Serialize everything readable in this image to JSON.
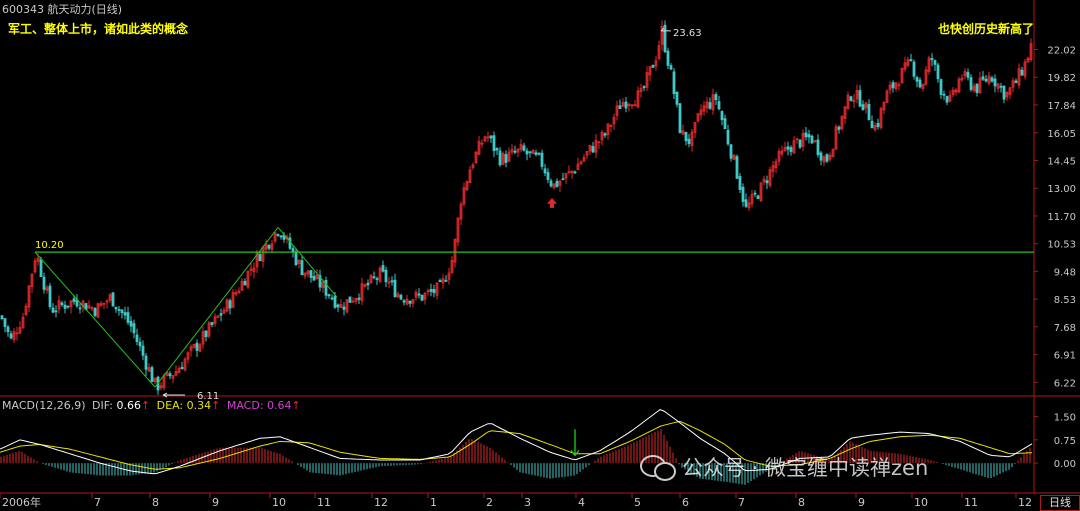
{
  "header": {
    "code": "600343",
    "name": "航天动力",
    "period": "(日线)"
  },
  "annotations": {
    "left_note": "军工、整体上市，诸如此类的概念",
    "right_note": "也快创历史新高了",
    "high_label": "23.63",
    "low_label": "6.11",
    "resistance_label": "10.20"
  },
  "macd": {
    "title": "MACD(12,26,9)",
    "dif_label": "DIF:",
    "dif_value": "0.66",
    "dea_label": "DEA:",
    "dea_value": "0.34",
    "macd_label": "MACD:",
    "macd_value": "0.64"
  },
  "watermark": "公众号 · 微宝缠中读禅zen",
  "period_box": "日线",
  "colors": {
    "background": "#000000",
    "axis_red": "#b01818",
    "up_candle": "#e0292a",
    "down_candle": "#3fc8c8",
    "resistance_line": "#22c322",
    "dif_line": "#ffffff",
    "dea_line": "#e8e200",
    "label_yellow": "#ffff00",
    "macd_purple": "#d040d0"
  },
  "chart_data": [
    {
      "type": "candlestick",
      "title": "600343 航天动力(日线)",
      "yscale": "log",
      "y_ticks": [
        6.22,
        6.91,
        7.68,
        8.53,
        9.48,
        10.53,
        11.7,
        13.0,
        14.45,
        16.05,
        17.84,
        19.82,
        22.02
      ],
      "ylim": [
        5.95,
        25.2
      ],
      "x_ticks": [
        "2006年",
        "7",
        "8",
        "9",
        "10",
        "11",
        "12",
        "1",
        "2",
        "3",
        "4",
        "5",
        "6",
        "7",
        "8",
        "9",
        "10",
        "11",
        "12"
      ],
      "close_path": [
        [
          0,
          8.0
        ],
        [
          10,
          7.3
        ],
        [
          22,
          8.0
        ],
        [
          35,
          10.2
        ],
        [
          50,
          8.2
        ],
        [
          75,
          8.5
        ],
        [
          95,
          8.2
        ],
        [
          110,
          8.6
        ],
        [
          130,
          7.7
        ],
        [
          155,
          6.11
        ],
        [
          175,
          6.5
        ],
        [
          200,
          7.3
        ],
        [
          230,
          8.5
        ],
        [
          260,
          10.2
        ],
        [
          278,
          11.2
        ],
        [
          300,
          9.6
        ],
        [
          320,
          9.0
        ],
        [
          340,
          8.3
        ],
        [
          360,
          8.8
        ],
        [
          380,
          9.4
        ],
        [
          400,
          8.6
        ],
        [
          420,
          8.6
        ],
        [
          440,
          8.9
        ],
        [
          452,
          10.0
        ],
        [
          460,
          12.5
        ],
        [
          470,
          14.2
        ],
        [
          485,
          16.0
        ],
        [
          500,
          14.5
        ],
        [
          520,
          15.0
        ],
        [
          540,
          14.4
        ],
        [
          552,
          13.1
        ],
        [
          570,
          13.8
        ],
        [
          590,
          15.1
        ],
        [
          605,
          16.0
        ],
        [
          620,
          18.0
        ],
        [
          640,
          18.5
        ],
        [
          655,
          21.5
        ],
        [
          661,
          23.63
        ],
        [
          670,
          20.0
        ],
        [
          680,
          16.0
        ],
        [
          690,
          15.5
        ],
        [
          700,
          17.5
        ],
        [
          715,
          18.3
        ],
        [
          725,
          16.0
        ],
        [
          735,
          14.0
        ],
        [
          745,
          12.0
        ],
        [
          760,
          13.0
        ],
        [
          775,
          14.4
        ],
        [
          790,
          15.3
        ],
        [
          810,
          15.8
        ],
        [
          825,
          14.4
        ],
        [
          835,
          16.0
        ],
        [
          850,
          18.6
        ],
        [
          860,
          18.2
        ],
        [
          875,
          16.3
        ],
        [
          885,
          18.5
        ],
        [
          900,
          20.0
        ],
        [
          910,
          21.0
        ],
        [
          920,
          19.0
        ],
        [
          930,
          21.5
        ],
        [
          940,
          19.0
        ],
        [
          950,
          18.0
        ],
        [
          960,
          20.0
        ],
        [
          975,
          19.0
        ],
        [
          990,
          20.0
        ],
        [
          1005,
          18.5
        ],
        [
          1015,
          19.5
        ],
        [
          1025,
          21.0
        ],
        [
          1034,
          23.5
        ]
      ],
      "annotations": [
        {
          "text": "10.20",
          "x": 35,
          "y": 10.2
        },
        {
          "text": "6.11",
          "x": 155,
          "y": 6.11
        },
        {
          "text": "23.63",
          "x": 661,
          "y": 23.63
        }
      ],
      "resistance_level": 10.2,
      "trend_lines": [
        [
          [
            35,
            10.2
          ],
          [
            155,
            6.11
          ]
        ],
        [
          [
            155,
            6.11
          ],
          [
            278,
            11.2
          ]
        ],
        [
          [
            278,
            11.2
          ],
          [
            337,
            8.6
          ]
        ]
      ],
      "markers": [
        {
          "type": "up-arrow",
          "x": 552,
          "y": 12.3
        }
      ]
    },
    {
      "type": "macd",
      "title": "MACD(12,26,9)",
      "y_ticks": [
        0.0,
        0.75,
        1.5
      ],
      "ylim": [
        -0.9,
        2.1
      ],
      "series": [
        {
          "name": "DIF",
          "points": [
            [
              0,
              0.45
            ],
            [
              20,
              0.75
            ],
            [
              40,
              0.6
            ],
            [
              70,
              0.3
            ],
            [
              100,
              0.0
            ],
            [
              130,
              -0.25
            ],
            [
              155,
              -0.35
            ],
            [
              180,
              -0.1
            ],
            [
              220,
              0.4
            ],
            [
              260,
              0.8
            ],
            [
              280,
              0.85
            ],
            [
              310,
              0.5
            ],
            [
              340,
              0.15
            ],
            [
              380,
              0.1
            ],
            [
              420,
              0.1
            ],
            [
              450,
              0.3
            ],
            [
              470,
              1.0
            ],
            [
              490,
              1.3
            ],
            [
              520,
              0.8
            ],
            [
              550,
              0.35
            ],
            [
              575,
              0.1
            ],
            [
              600,
              0.4
            ],
            [
              630,
              1.0
            ],
            [
              661,
              1.75
            ],
            [
              680,
              1.3
            ],
            [
              700,
              0.8
            ],
            [
              725,
              0.3
            ],
            [
              745,
              -0.25
            ],
            [
              770,
              -0.2
            ],
            [
              800,
              0.15
            ],
            [
              830,
              0.2
            ],
            [
              850,
              0.8
            ],
            [
              870,
              0.9
            ],
            [
              900,
              1.0
            ],
            [
              930,
              0.95
            ],
            [
              960,
              0.7
            ],
            [
              990,
              0.25
            ],
            [
              1010,
              0.2
            ],
            [
              1034,
              0.66
            ]
          ]
        },
        {
          "name": "DEA",
          "points": [
            [
              0,
              0.35
            ],
            [
              20,
              0.55
            ],
            [
              40,
              0.6
            ],
            [
              70,
              0.45
            ],
            [
              100,
              0.2
            ],
            [
              130,
              -0.05
            ],
            [
              155,
              -0.2
            ],
            [
              180,
              -0.15
            ],
            [
              220,
              0.15
            ],
            [
              260,
              0.55
            ],
            [
              280,
              0.7
            ],
            [
              310,
              0.65
            ],
            [
              340,
              0.35
            ],
            [
              380,
              0.15
            ],
            [
              420,
              0.12
            ],
            [
              450,
              0.2
            ],
            [
              470,
              0.6
            ],
            [
              490,
              1.05
            ],
            [
              520,
              0.95
            ],
            [
              550,
              0.6
            ],
            [
              575,
              0.3
            ],
            [
              600,
              0.3
            ],
            [
              630,
              0.7
            ],
            [
              661,
              1.2
            ],
            [
              680,
              1.35
            ],
            [
              700,
              1.05
            ],
            [
              725,
              0.6
            ],
            [
              745,
              0.1
            ],
            [
              770,
              -0.1
            ],
            [
              800,
              -0.05
            ],
            [
              830,
              0.15
            ],
            [
              850,
              0.45
            ],
            [
              870,
              0.7
            ],
            [
              900,
              0.85
            ],
            [
              930,
              0.9
            ],
            [
              960,
              0.8
            ],
            [
              990,
              0.5
            ],
            [
              1010,
              0.3
            ],
            [
              1034,
              0.34
            ]
          ]
        }
      ],
      "latest": {
        "DIF": 0.66,
        "DEA": 0.34,
        "MACD": 0.64
      },
      "markers": [
        {
          "type": "down-arrow",
          "x": 575,
          "y": 0.25
        }
      ]
    }
  ]
}
